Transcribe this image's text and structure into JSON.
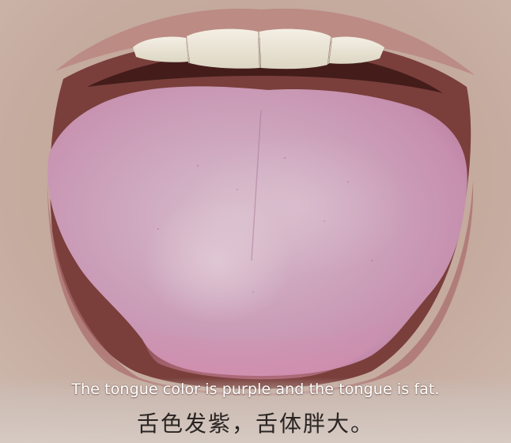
{
  "caption": {
    "english": "The tongue color is purple and the tongue is fat.",
    "chinese": "舌色发紫，舌体胖大。"
  },
  "colors": {
    "skin": "#c9b0a3",
    "lips": "#b07a78",
    "mouth_interior": "#5a2a28",
    "teeth": "#efe9dc",
    "tongue": "#c99ab4",
    "tongue_tip": "#d98fb0",
    "tongue_coating": "#d9bfcf"
  },
  "photo": {
    "subject": "tongue-photo"
  }
}
